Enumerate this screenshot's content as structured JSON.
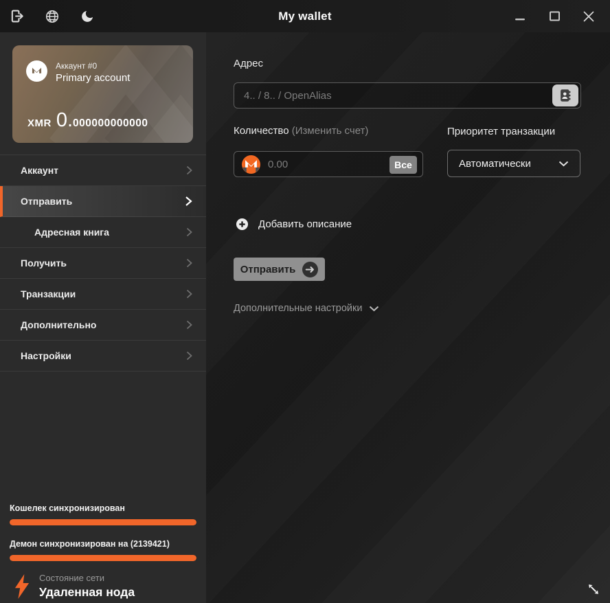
{
  "titlebar": {
    "title": "My wallet"
  },
  "account_card": {
    "account_index_label": "Аккаунт #0",
    "account_name": "Primary account",
    "currency": "XMR",
    "balance_whole": "0.",
    "balance_decimals": "000000000000"
  },
  "sidebar": {
    "items": [
      {
        "label": "Аккаунт"
      },
      {
        "label": "Отправить",
        "selected": true
      },
      {
        "label": "Адресная книга",
        "sub": true
      },
      {
        "label": "Получить"
      },
      {
        "label": "Транзакции"
      },
      {
        "label": "Дополнительно"
      },
      {
        "label": "Настройки"
      }
    ],
    "status": {
      "wallet_sync_label": "Кошелек синхронизирован",
      "wallet_sync_progress": "100%",
      "daemon_sync_label": "Демон синхронизирован на (2139421)",
      "daemon_sync_progress": "100%",
      "network_caption": "Состояние сети",
      "network_status": "Удаленная нода"
    }
  },
  "send_form": {
    "address_label": "Адрес",
    "address_placeholder": "4.. / 8.. / OpenAlias",
    "amount_label": "Количество",
    "amount_hint": "(Изменить счет)",
    "amount_placeholder": "0.00",
    "all_button_label": "Все",
    "priority_label": "Приоритет транзакции",
    "priority_value": "Автоматически",
    "add_description_label": "Добавить описание",
    "send_button_label": "Отправить",
    "advanced_label": "Дополнительные настройки"
  },
  "colors": {
    "accent_orange": "#f1662a",
    "monero_orange": "#f26822"
  }
}
